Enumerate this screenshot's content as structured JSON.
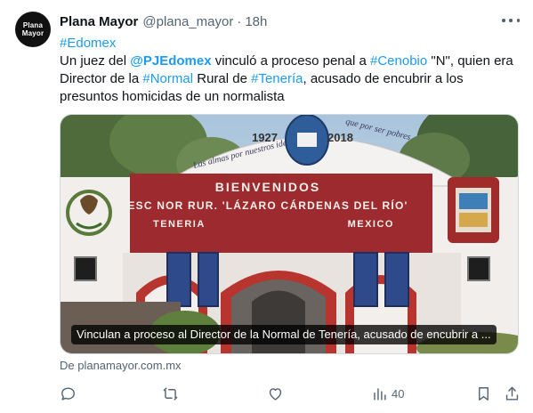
{
  "tweet": {
    "avatar_text": [
      "Plana",
      "Mayor"
    ],
    "display_name": "Plana Mayor",
    "handle": "@plana_mayor",
    "separator": "·",
    "time": "18h",
    "hashtag_line": "#Edomex",
    "body": {
      "p1": "Un juez del ",
      "mention": "@PJEdomex",
      "p2": "  vinculó a proceso penal a ",
      "tag_cenobio": "#Cenobio",
      "p3": " \"N\", quien era",
      "p4": "Director de la ",
      "tag_normal": "#Normal",
      "p5": " Rural de ",
      "tag_teneria": "#Tenería",
      "p6": ", acusado de encubrir a los",
      "p7": "presuntos homicidas de un normalista"
    },
    "media": {
      "caption": "Vinculan a proceso al Director de la Normal de Tenería, acusado de encubrir a ...",
      "sign_welcome": "BIENVENIDOS",
      "sign_school": "ESC NOR RUR. 'LÁZARO CÁRDENAS DEL RÍO'",
      "sign_place": "TENERIA",
      "sign_state": "MEXICO",
      "year_left": "1927",
      "year_right": "2018",
      "arch_text_left": "Las almas por nuestros ideales",
      "arch_text_right": "que por ser pobres"
    },
    "source": "De planamayor.com.mx",
    "actions": {
      "reply_count": "",
      "retweet_count": "",
      "like_count": "",
      "views_count": "40"
    }
  }
}
